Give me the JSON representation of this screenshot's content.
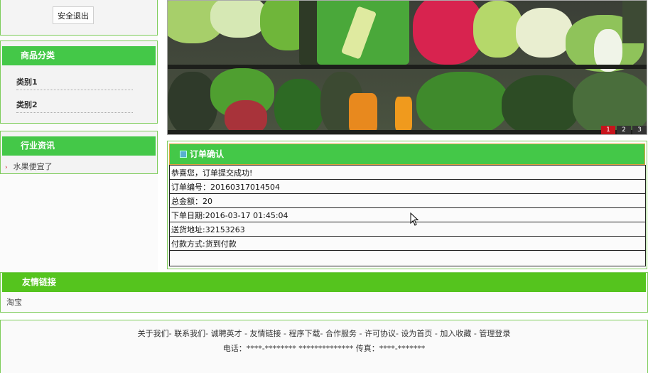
{
  "sidebar": {
    "logout_label": "安全退出",
    "category": {
      "title": "商品分类",
      "items": [
        {
          "label": "类别1"
        },
        {
          "label": "类别2"
        }
      ]
    },
    "news": {
      "title": "行业资讯",
      "items": [
        {
          "label": "水果便宜了"
        }
      ]
    }
  },
  "banner": {
    "pager": [
      "1",
      "2",
      "3"
    ],
    "active_page": "1"
  },
  "order": {
    "title": "订单确认",
    "rows": [
      {
        "text": "恭喜您，订单提交成功!"
      },
      {
        "label": "订单编号：",
        "value": "20160317014504"
      },
      {
        "label": "总金额：",
        "value": "20"
      },
      {
        "label": "下单日期:",
        "value": "2016-03-17 01:45:04"
      },
      {
        "label": "送货地址:",
        "value": "32153263"
      },
      {
        "label": "付款方式:",
        "value": "货到付款"
      }
    ]
  },
  "links": {
    "title": "友情链接",
    "items": [
      {
        "label": "淘宝"
      }
    ]
  },
  "footer": {
    "nav": [
      "关于我们",
      "联系我们",
      "诚聘英才",
      "友情链接",
      "程序下载",
      "合作服务",
      "许可协议",
      "设为首页",
      "加入收藏",
      "管理登录"
    ],
    "phone_label": "电话：",
    "phone_value": "****-******** **************",
    "fax_label": "传真：",
    "fax_value": "****-*******"
  },
  "colors": {
    "accent_green": "#44c848",
    "border_green": "#7dcc5a",
    "pager_active": "#c8141c"
  }
}
